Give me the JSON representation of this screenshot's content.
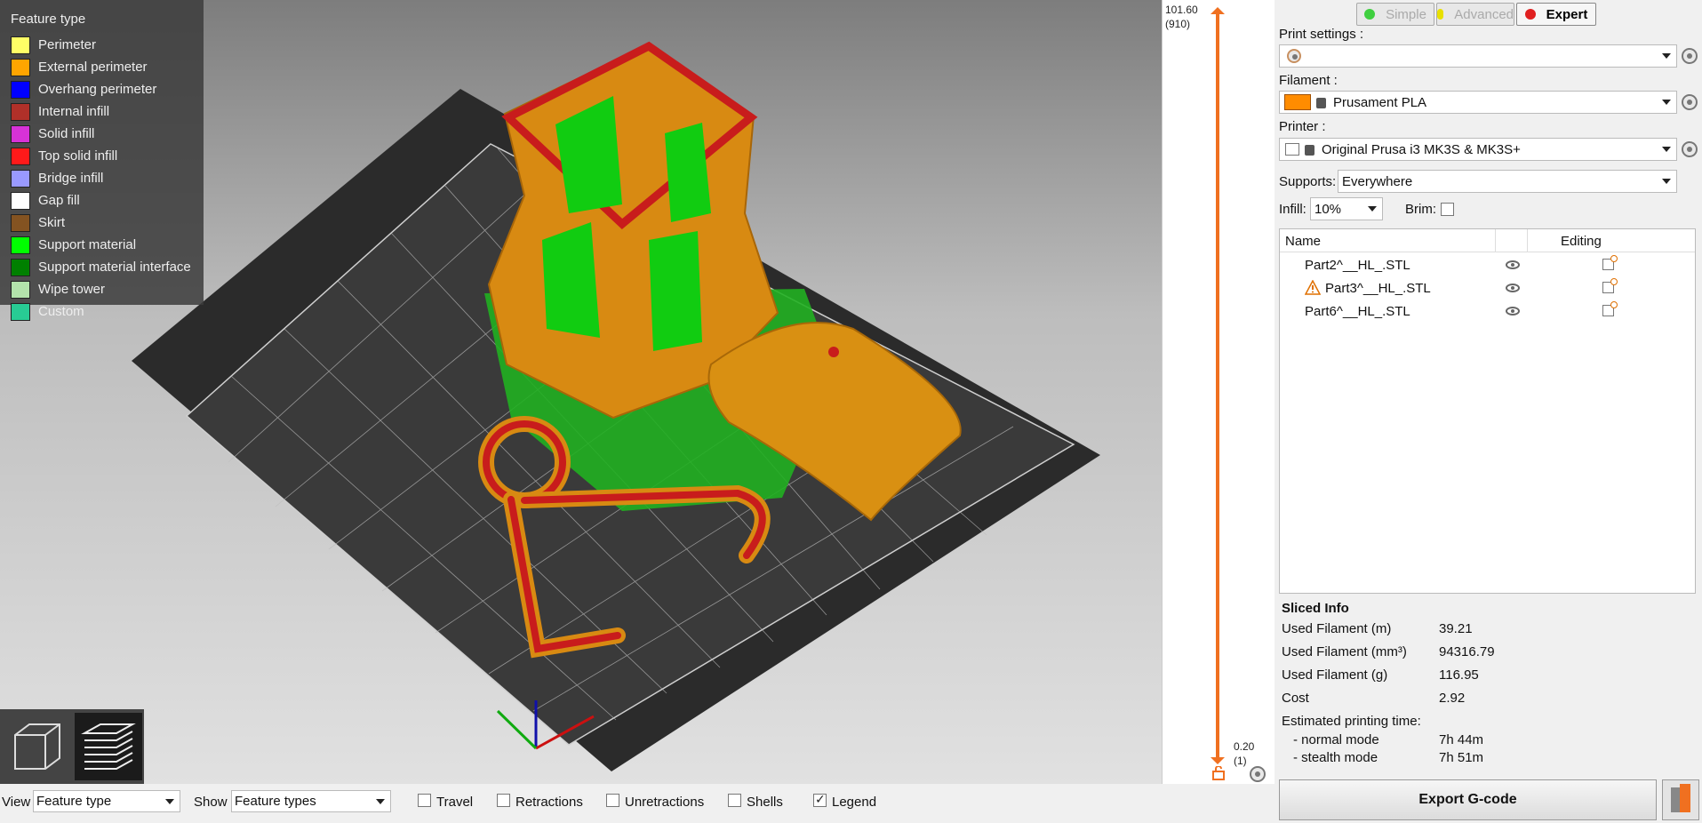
{
  "legend": {
    "title": "Feature type",
    "items": [
      {
        "label": "Perimeter",
        "color": "#ffff66"
      },
      {
        "label": "External perimeter",
        "color": "#ffa500"
      },
      {
        "label": "Overhang perimeter",
        "color": "#0000ff"
      },
      {
        "label": "Internal infill",
        "color": "#b03029"
      },
      {
        "label": "Solid infill",
        "color": "#d732d7"
      },
      {
        "label": "Top solid infill",
        "color": "#ff1a1a"
      },
      {
        "label": "Bridge infill",
        "color": "#9999ff"
      },
      {
        "label": "Gap fill",
        "color": "#ffffff"
      },
      {
        "label": "Skirt",
        "color": "#845321"
      },
      {
        "label": "Support material",
        "color": "#00ff00"
      },
      {
        "label": "Support material interface",
        "color": "#008000"
      },
      {
        "label": "Wipe tower",
        "color": "#b3e3ab"
      },
      {
        "label": "Custom",
        "color": "#28cc94"
      }
    ]
  },
  "slider": {
    "top_value": "101.60",
    "top_layer": "(910)",
    "bottom_value": "0.20",
    "bottom_layer": "(1)"
  },
  "modes": [
    {
      "label": "Simple",
      "color": "#3fcf3f"
    },
    {
      "label": "Advanced",
      "color": "#e8e000"
    },
    {
      "label": "Expert",
      "color": "#e02020"
    }
  ],
  "settings": {
    "print_label": "Print settings :",
    "print_value": "",
    "filament_label": "Filament :",
    "filament_value": "Prusament PLA",
    "filament_color": "#ff8c00",
    "printer_label": "Printer :",
    "printer_value": "Original Prusa i3 MK3S & MK3S+",
    "supports_label": "Supports:",
    "supports_value": "Everywhere",
    "infill_label": "Infill:",
    "infill_value": "10%",
    "brim_label": "Brim:"
  },
  "objects": {
    "col_name": "Name",
    "col_editing": "Editing",
    "items": [
      {
        "name": "Part2^__HL_.STL",
        "warning": false
      },
      {
        "name": "Part3^__HL_.STL",
        "warning": true
      },
      {
        "name": "Part6^__HL_.STL",
        "warning": false
      }
    ]
  },
  "sliced_info": {
    "title": "Sliced Info",
    "rows": [
      {
        "k": "Used Filament (m)",
        "v": "39.21"
      },
      {
        "k": "Used Filament (mm³)",
        "v": "94316.79"
      },
      {
        "k": "Used Filament (g)",
        "v": "116.95"
      },
      {
        "k": "Cost",
        "v": "2.92"
      }
    ],
    "time_title": "Estimated printing time:",
    "normal_label": "- normal mode",
    "normal_value": "7h 44m",
    "stealth_label": "- stealth mode",
    "stealth_value": "7h 51m"
  },
  "export_label": "Export G-code",
  "bottom": {
    "view_label": "View",
    "view_value": "Feature type",
    "show_label": "Show",
    "show_value": "Feature types",
    "checks": [
      {
        "label": "Travel",
        "checked": false
      },
      {
        "label": "Retractions",
        "checked": false
      },
      {
        "label": "Unretractions",
        "checked": false
      },
      {
        "label": "Shells",
        "checked": false
      },
      {
        "label": "Legend",
        "checked": true
      }
    ]
  }
}
